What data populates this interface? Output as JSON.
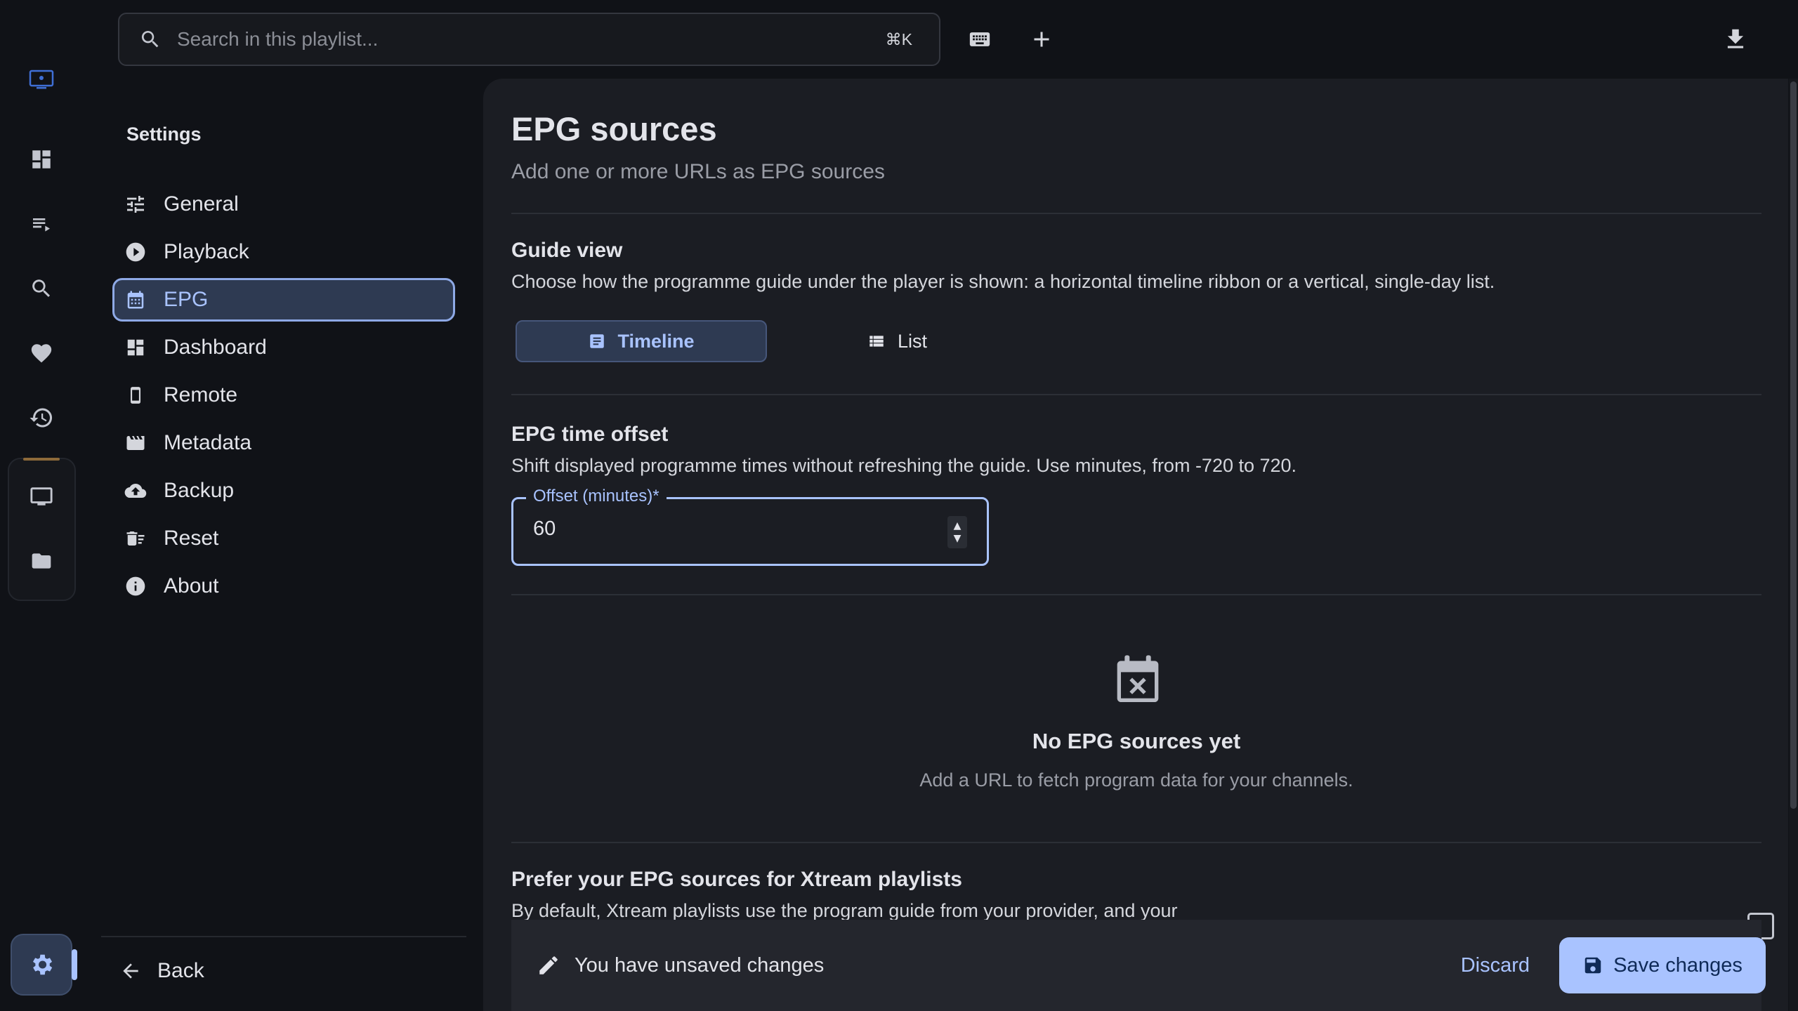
{
  "search": {
    "placeholder": "Search in this playlist...",
    "shortcut": "⌘K"
  },
  "nav": {
    "title": "Settings",
    "items": [
      {
        "label": "General",
        "icon": "tune-icon"
      },
      {
        "label": "Playback",
        "icon": "play-circle-icon"
      },
      {
        "label": "EPG",
        "icon": "calendar-icon",
        "active": true
      },
      {
        "label": "Dashboard",
        "icon": "dashboard-icon"
      },
      {
        "label": "Remote",
        "icon": "phone-icon"
      },
      {
        "label": "Metadata",
        "icon": "clapperboard-icon"
      },
      {
        "label": "Backup",
        "icon": "cloud-upload-icon"
      },
      {
        "label": "Reset",
        "icon": "clear-all-icon"
      },
      {
        "label": "About",
        "icon": "info-icon"
      }
    ],
    "back_label": "Back"
  },
  "main": {
    "title": "EPG sources",
    "subtitle": "Add one or more URLs as EPG sources",
    "guide_view": {
      "title": "Guide view",
      "description": "Choose how the programme guide under the player is shown: a horizontal timeline ribbon or a vertical, single-day list.",
      "options": [
        "Timeline",
        "List"
      ],
      "selected": "Timeline"
    },
    "offset": {
      "title": "EPG time offset",
      "description": "Shift displayed programme times without refreshing the guide. Use minutes, from -720 to 720.",
      "label": "Offset (minutes)*",
      "value": "60"
    },
    "empty": {
      "title": "No EPG sources yet",
      "description": "Add a URL to fetch program data for your channels."
    },
    "prefer": {
      "title": "Prefer your EPG sources for Xtream playlists",
      "description": "By default, Xtream playlists use the program guide from your provider, and your"
    }
  },
  "savebar": {
    "message": "You have unsaved changes",
    "discard_label": "Discard",
    "save_label": "Save changes"
  },
  "colors": {
    "accent": "#a9c3ff",
    "background": "#101217",
    "panel": "#1b1d23"
  }
}
